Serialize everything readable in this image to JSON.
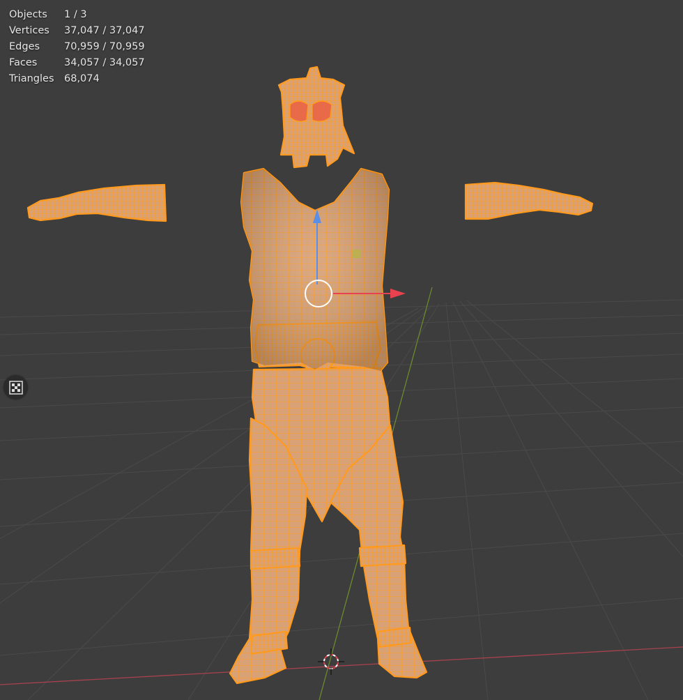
{
  "stats": [
    {
      "label": "Objects",
      "value": "1 / 3"
    },
    {
      "label": "Vertices",
      "value": "37,047 / 37,047"
    },
    {
      "label": "Edges",
      "value": "70,959 / 70,959"
    },
    {
      "label": "Faces",
      "value": "34,057 / 34,057"
    },
    {
      "label": "Triangles",
      "value": "68,074"
    }
  ],
  "colors": {
    "background": "#3d3d3d",
    "grid": "#4a4a4a",
    "x_axis": "#a8424e",
    "y_axis": "#6b8a2e",
    "mesh_fill": "#d9a276",
    "wire": "#ff9a1f",
    "gizmo_x": "#e8414f",
    "gizmo_z": "#5b8ee6",
    "overlay_button": "#2b2b2b"
  },
  "icons": {
    "overlay_button": "checker-grid-icon",
    "cursor": "3d-cursor-icon"
  }
}
